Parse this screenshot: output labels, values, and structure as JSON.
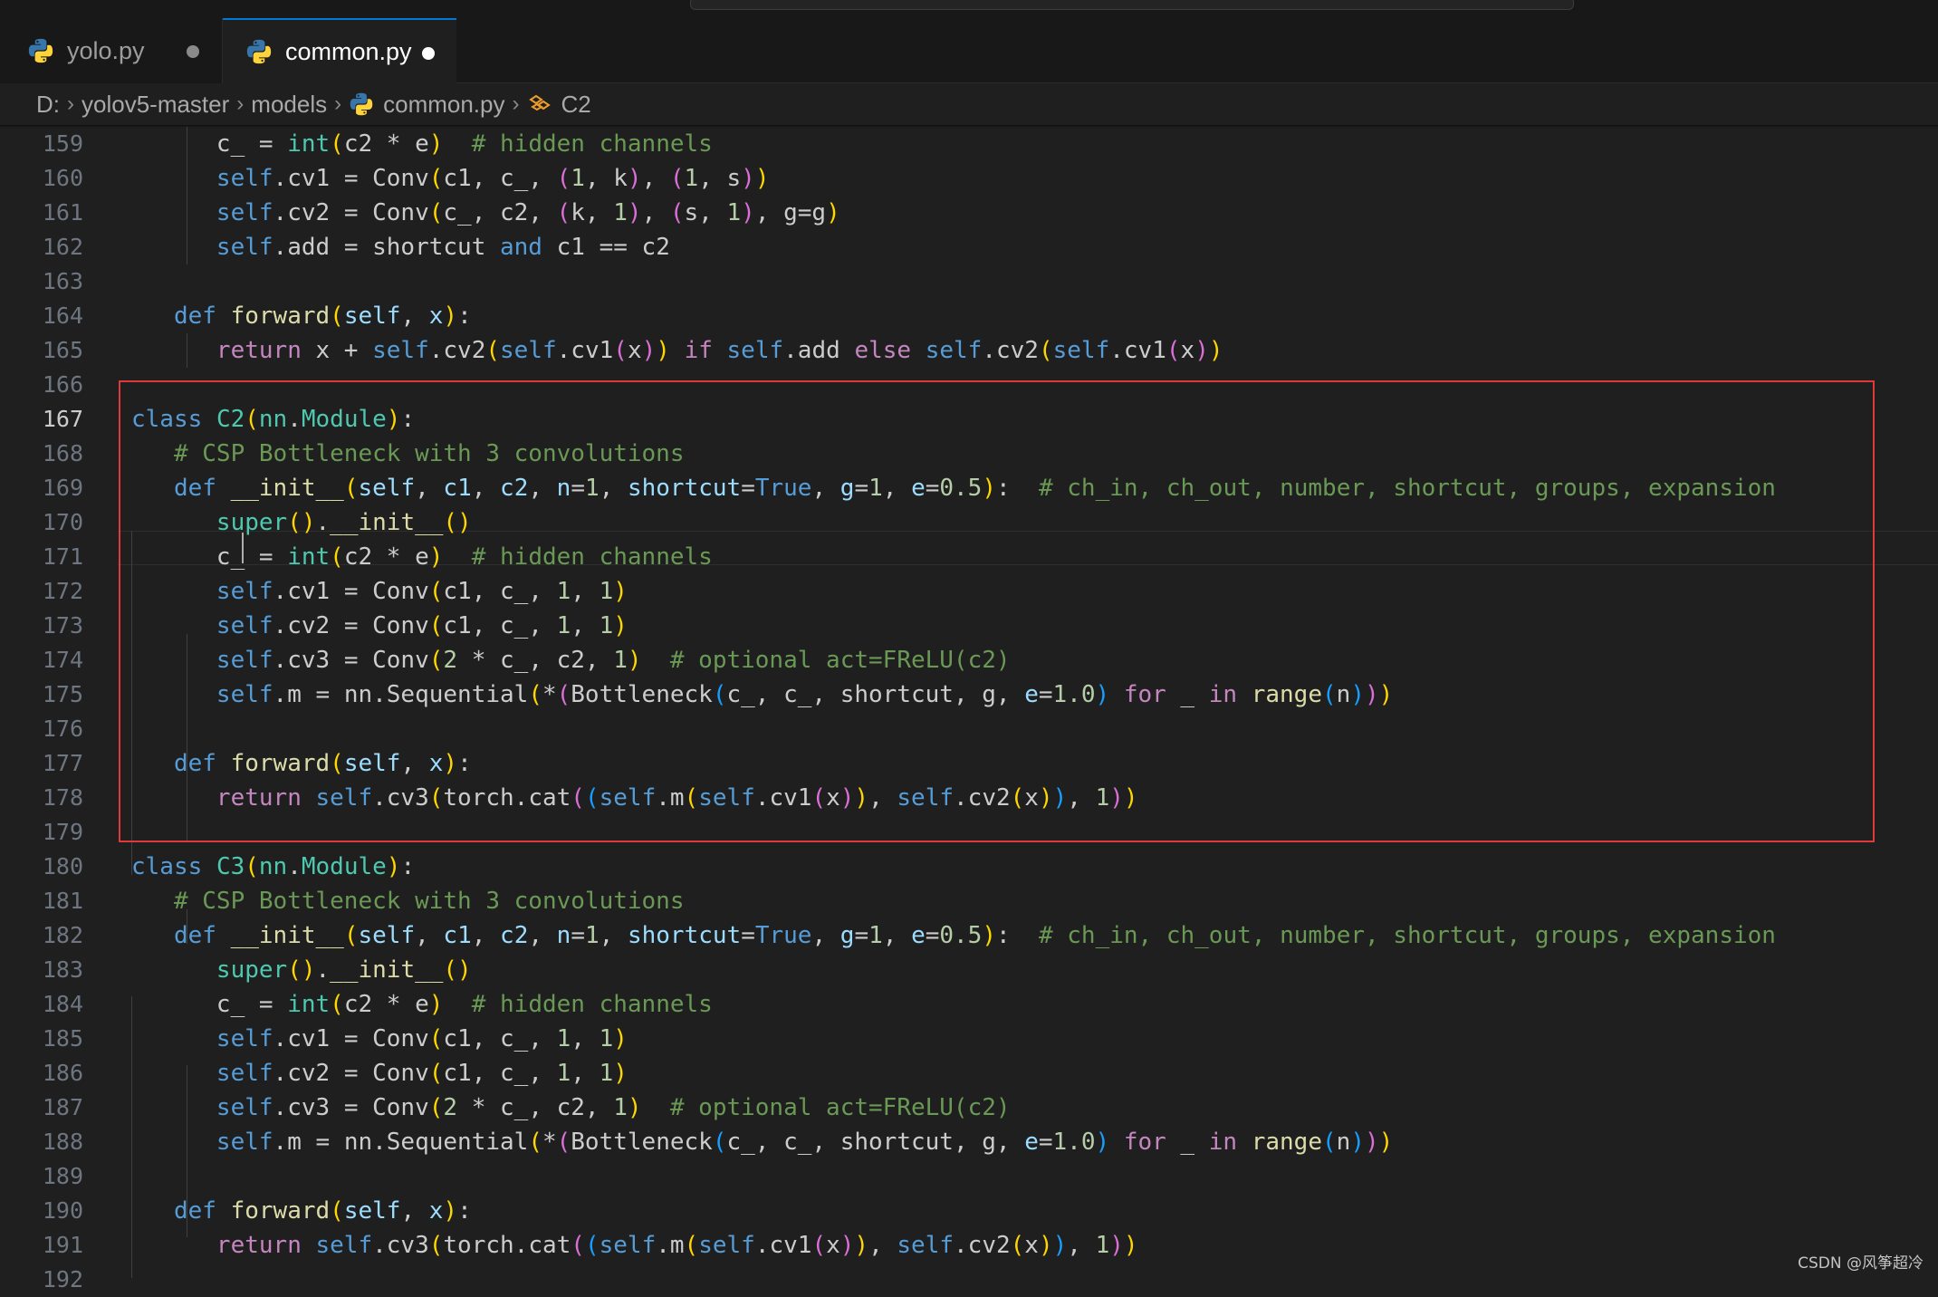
{
  "tabs": [
    {
      "label": "yolo.py",
      "modified": true,
      "active": false
    },
    {
      "label": "common.py",
      "modified": true,
      "active": true
    }
  ],
  "breadcrumb": {
    "drive": "D:",
    "folder1": "yolov5-master",
    "folder2": "models",
    "file": "common.py",
    "symbol": "C2"
  },
  "editor": {
    "line_numbers": [
      "159",
      "160",
      "161",
      "162",
      "163",
      "164",
      "165",
      "166",
      "167",
      "168",
      "169",
      "170",
      "171",
      "172",
      "173",
      "174",
      "175",
      "176",
      "177",
      "178",
      "179",
      "180",
      "181",
      "182",
      "183",
      "184",
      "185",
      "186",
      "187",
      "188",
      "189",
      "190",
      "191",
      "192"
    ],
    "active_line": "167"
  },
  "colors": {
    "highlight_box": "#e0393b",
    "keyword": "#569cd6",
    "control": "#c586c0",
    "function": "#dcdcaa",
    "class": "#4ec9b0",
    "comment": "#6a9955"
  },
  "watermark": "CSDN @风筝超冷"
}
